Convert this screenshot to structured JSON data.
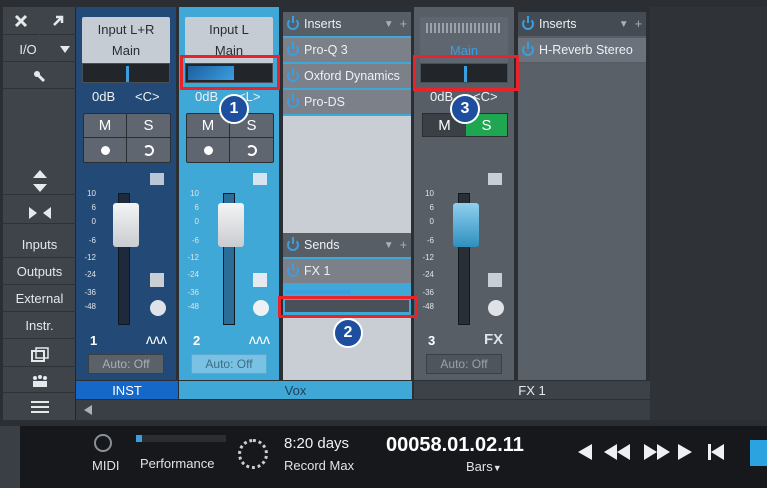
{
  "sidebar": {
    "close_icon": "x-icon",
    "expand_icon": "arrow-diagonal-icon",
    "io_label": "I/O",
    "tool_icon": "wrench-icon",
    "items": [
      "Inputs",
      "Outputs",
      "External",
      "Instr."
    ]
  },
  "channels": [
    {
      "name": "Input L+R",
      "output": "Main",
      "volume": "0dB",
      "pan": "<C>",
      "mute": "M",
      "solo": "S",
      "number": "1",
      "automation": "Auto: Off",
      "footer": "INST"
    },
    {
      "name": "Input L",
      "output": "Main",
      "volume": "0dB",
      "pan": "<L>",
      "mute": "M",
      "solo": "S",
      "number": "2",
      "automation": "Auto: Off",
      "footer": "Vox"
    },
    {
      "name": "",
      "output": "Main",
      "volume": "0dB",
      "pan": "<C>",
      "mute": "M",
      "solo": "S",
      "number": "3",
      "automation": "Auto: Off",
      "footer": "FX 1",
      "fx_tag": "FX"
    }
  ],
  "fader_scale": [
    "10",
    "6",
    "0",
    "-6",
    "-12",
    "-24",
    "-36",
    "-48"
  ],
  "vox_inserts": {
    "title": "Inserts",
    "plugins": [
      "Pro-Q 3",
      "Oxford Dynamics",
      "Pro-DS"
    ]
  },
  "vox_sends": {
    "title": "Sends",
    "items": [
      "FX 1"
    ]
  },
  "fx_inserts": {
    "title": "Inserts",
    "plugins": [
      "H-Reverb Stereo"
    ]
  },
  "callouts": [
    "1",
    "2",
    "3"
  ],
  "transport": {
    "midi_label": "MIDI",
    "performance_label": "Performance",
    "record_days": "8:20 days",
    "record_label": "Record Max",
    "position": "00058.01.02.11",
    "position_unit": "Bars"
  },
  "colors": {
    "accent": "#3a9ee0",
    "highlight": "#e8242a",
    "solo_active": "#1fa650",
    "vox_strip": "#40a8d6"
  }
}
